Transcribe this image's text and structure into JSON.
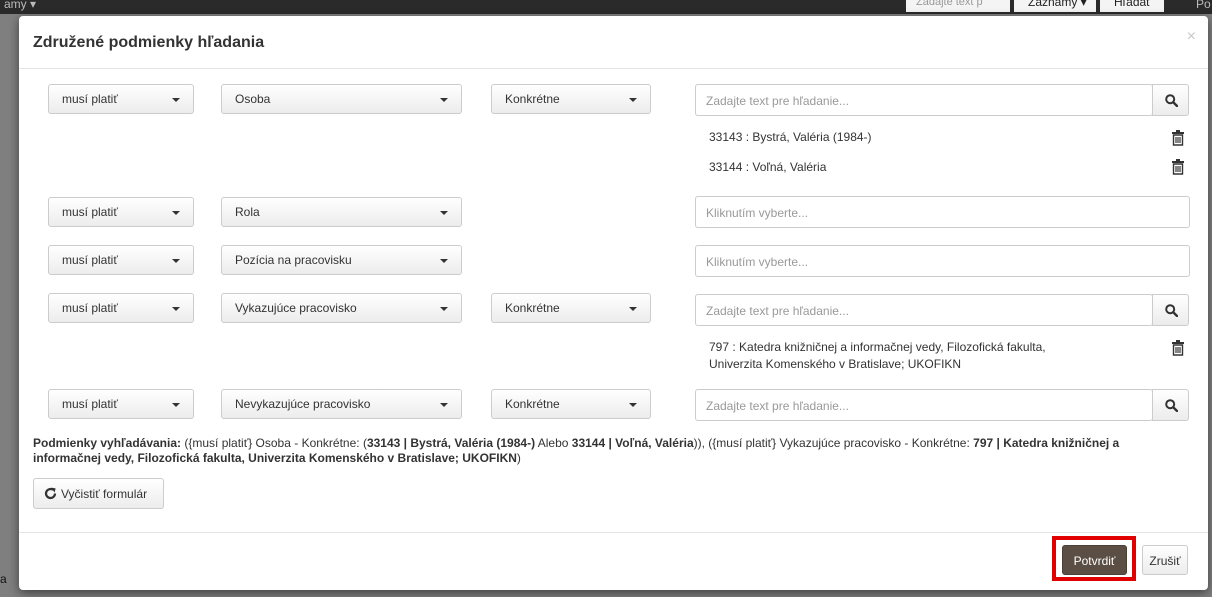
{
  "background": {
    "nav_fragment_left": "amy ▾",
    "search_placeholder_fragment": "Zadajte text p",
    "zaznamy_fragment": "Záznamy ▾",
    "hladat_fragment": "Hľadať",
    "right_fragment": "Po",
    "left_bottom_fragment": "a"
  },
  "modal": {
    "title": "Združené podmienky hľadania",
    "close_label": "×"
  },
  "rows": [
    {
      "condition": "musí platiť",
      "field": "Osoba",
      "mode": "Konkrétne",
      "input_placeholder": "Zadajte text pre hľadanie...",
      "items": [
        "33143 : Bystrá, Valéria (1984-)",
        "33144 : Voľná, Valéria"
      ]
    },
    {
      "condition": "musí platiť",
      "field": "Rola",
      "input_placeholder": "Kliknutím vyberte..."
    },
    {
      "condition": "musí platiť",
      "field": "Pozícia na pracovisku",
      "input_placeholder": "Kliknutím vyberte..."
    },
    {
      "condition": "musí platiť",
      "field": "Vykazujúce pracovisko",
      "mode": "Konkrétne",
      "input_placeholder": "Zadajte text pre hľadanie...",
      "items": [
        "797 : Katedra knižničnej a informačnej vedy, Filozofická fakulta, Univerzita Komenského v Bratislave; UKOFIKN"
      ]
    },
    {
      "condition": "musí platiť",
      "field": "Nevykazujúce pracovisko",
      "mode": "Konkrétne",
      "input_placeholder": "Zadajte text pre hľadanie..."
    }
  ],
  "summary": {
    "label": "Podmienky vyhľadávania:",
    "p1": " ({musí platiť} Osoba - Konkrétne: (",
    "b1": "33143 | Bystrá, Valéria (1984-)",
    "p2": " Alebo ",
    "b2": "33144 | Voľná, Valéria",
    "p3": ")), ({musí platiť} Vykazujúce pracovisko - Konkrétne: ",
    "b3": "797 | Katedra knižničnej a informačnej vedy, Filozofická fakulta, Univerzita Komenského v Bratislave; UKOFIKN",
    "p4": ")"
  },
  "buttons": {
    "clear": "Vyčistiť formulár",
    "confirm": "Potvrdiť",
    "cancel": "Zrušiť"
  },
  "colors": {
    "confirm_bg": "#5b4f45",
    "highlight": "#e00000"
  }
}
